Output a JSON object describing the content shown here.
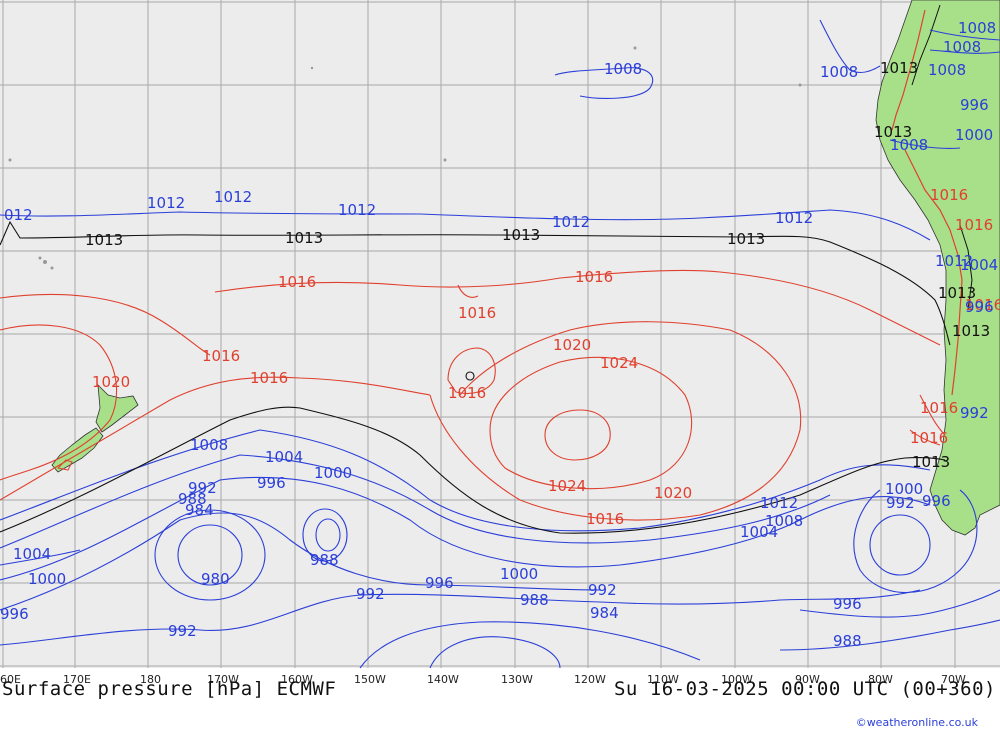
{
  "title": "Surface pressure [hPa] ECMWF",
  "datetime": "Su 16-03-2025 00:00 UTC (00+360)",
  "credit": "©weatheronline.co.uk",
  "colors": {
    "ocean": "#ececec",
    "land": "#a8e08a",
    "grid": "#a9a9a9",
    "low": "#2b3fd8",
    "high": "#e0402e",
    "standard": "#111111",
    "mountain": "#e0402e"
  },
  "lon_ticks": [
    "60E",
    "170E",
    "180",
    "170W",
    "160W",
    "150W",
    "140W",
    "130W",
    "120W",
    "110W",
    "100W",
    "90W",
    "80W",
    "70W"
  ],
  "isobars": {
    "black": [
      "1013",
      "1013",
      "1013",
      "1013",
      "1013",
      "1013",
      "1013",
      "1013",
      "1013"
    ],
    "red": [
      "1016",
      "1016",
      "1016",
      "1016",
      "1016",
      "1016",
      "1016",
      "1020",
      "1020",
      "1024",
      "1024",
      "1020",
      "1016",
      "1016",
      "1016",
      "1016",
      "1016"
    ],
    "blue": [
      "1012",
      "1012",
      "1012",
      "1012",
      "1012",
      "1012",
      "012",
      "1008",
      "1008",
      "1008",
      "1008",
      "1008",
      "1004",
      "1000",
      "1004",
      "1000",
      "1012",
      "1008",
      "1004",
      "996",
      "992",
      "988",
      "984",
      "980",
      "988",
      "992",
      "996",
      "1000",
      "996",
      "992",
      "988",
      "984",
      "992",
      "996",
      "988",
      "992",
      "996",
      "1000",
      "992",
      "996",
      "1004",
      "1000",
      "996",
      "1008",
      "1008"
    ]
  }
}
